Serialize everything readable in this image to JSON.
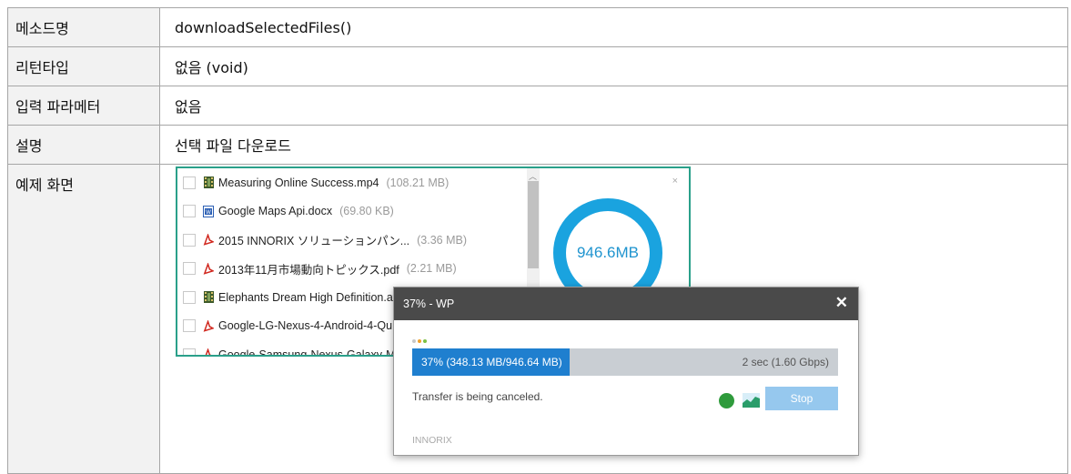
{
  "table": {
    "rows": [
      {
        "key": "메소드명",
        "value": "downloadSelectedFiles()"
      },
      {
        "key": "리턴타입",
        "value": "없음 (void)"
      },
      {
        "key": "입력 파라메터",
        "value": "없음"
      },
      {
        "key": "설명",
        "value": "선택 파일 다운로드"
      },
      {
        "key": "예제 화면",
        "value": ""
      }
    ]
  },
  "file_list": {
    "files": [
      {
        "name": "Measuring Online Success.mp4",
        "size": "(108.21 MB)",
        "icon": "video-icon"
      },
      {
        "name": "Google Maps Api.docx",
        "size": "(69.80 KB)",
        "icon": "word-doc-icon"
      },
      {
        "name": "2015 INNORIX ソリューションパン...",
        "size": "(3.36 MB)",
        "icon": "pdf-icon"
      },
      {
        "name": "2013年11月市場動向トピックス.pdf",
        "size": "(2.21 MB)",
        "icon": "pdf-icon"
      },
      {
        "name": "Elephants Dream High Definition.avi",
        "size": "",
        "icon": "video-icon"
      },
      {
        "name": "Google-LG-Nexus-4-Android-4-Qu",
        "size": "",
        "icon": "pdf-icon"
      },
      {
        "name": "Google-Samsung-Nexus-Galaxy-M",
        "size": "",
        "icon": "pdf-icon"
      }
    ],
    "total": "946.6MB",
    "close": "×",
    "ring_color": "#1aa3df"
  },
  "dialog": {
    "title": "37% - WP",
    "close": "✕",
    "progress_text": "37% (348.13 MB/946.64 MB)",
    "progress_fraction": 0.37,
    "speed": "2 sec (1.60 Gbps)",
    "status": "Transfer is being canceled.",
    "stop": "Stop",
    "brand": "INNORIX",
    "bar_color": "#1f7fcf",
    "dots": [
      "#c7c7c7",
      "#f0a12a",
      "#7dc142"
    ]
  }
}
